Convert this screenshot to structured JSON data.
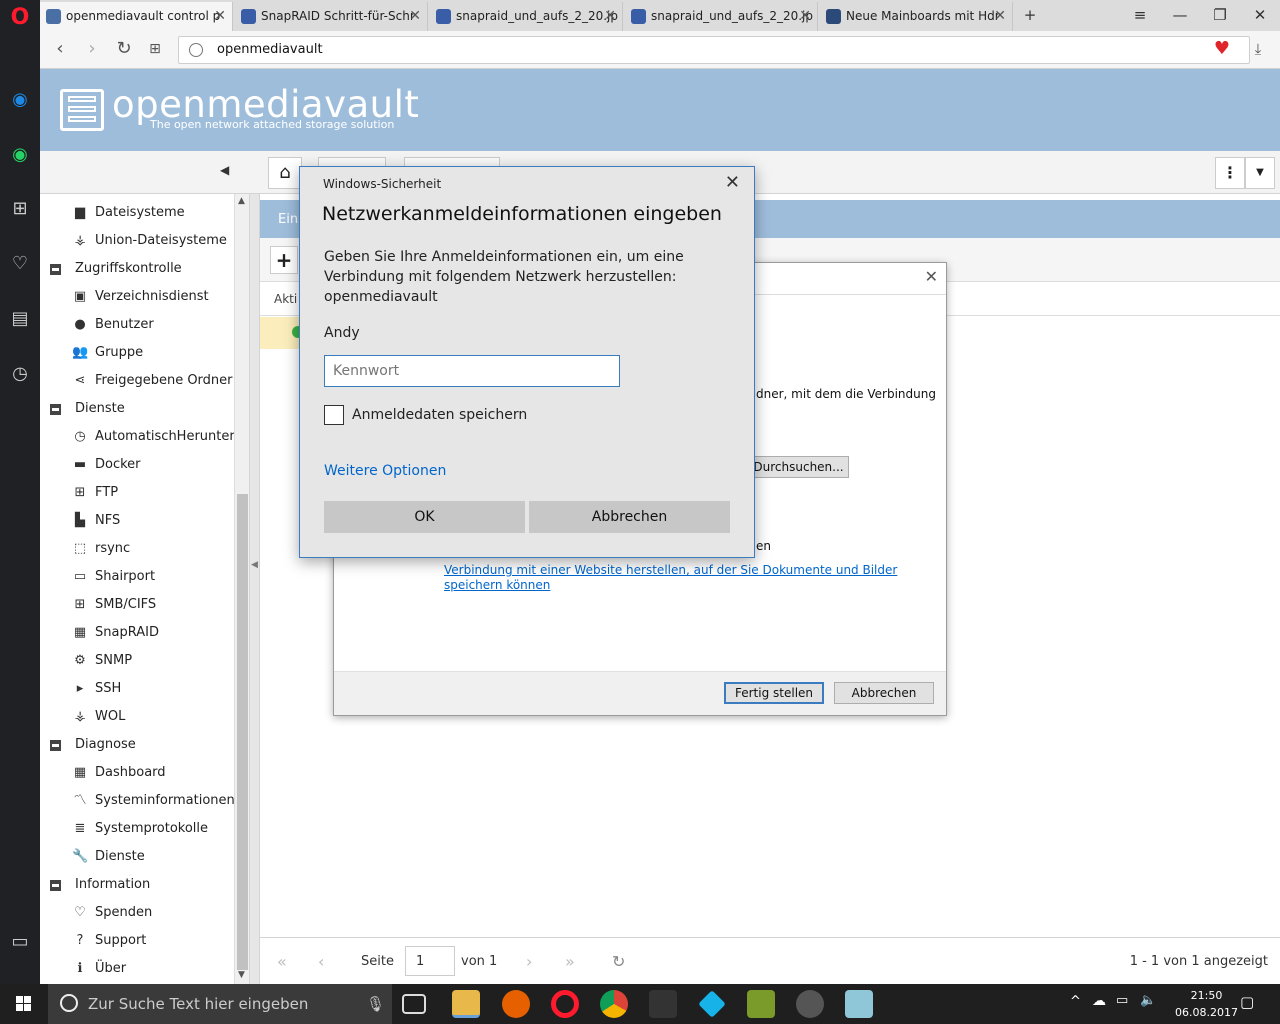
{
  "browser": {
    "tabs": [
      {
        "label": "openmediavault control p",
        "color": "#4a6fa5",
        "active": true
      },
      {
        "label": "SnapRAID Schritt-für-Schr",
        "color": "#3a5da8"
      },
      {
        "label": "snapraid_und_aufs_2_20.jp",
        "color": "#3a5da8"
      },
      {
        "label": "snapraid_und_aufs_2_20.jp",
        "color": "#3a5da8"
      },
      {
        "label": "Neue Mainboards mit Hdr",
        "color": "#2b4a7a"
      }
    ],
    "url": "openmediavault"
  },
  "omv": {
    "logo_title": "openmediavault",
    "logo_subtitle": "The open network attached storage solution",
    "panel_title": "Eins",
    "grid_header": "Akti"
  },
  "nav": {
    "items": [
      {
        "label": "Dateisysteme",
        "icon": "folder-icon",
        "glyph": "▆",
        "group": false
      },
      {
        "label": "Union-Dateisysteme",
        "icon": "hierarchy-icon",
        "glyph": "⚶",
        "group": false
      },
      {
        "label": "Zugriffskontrolle",
        "icon": "collapse-icon",
        "glyph": "",
        "group": true
      },
      {
        "label": "Verzeichnisdienst",
        "icon": "address-book-icon",
        "glyph": "▣",
        "group": false
      },
      {
        "label": "Benutzer",
        "icon": "user-icon",
        "glyph": "●",
        "group": false
      },
      {
        "label": "Gruppe",
        "icon": "users-icon",
        "glyph": "👥",
        "group": false
      },
      {
        "label": "Freigegebene Ordner",
        "icon": "share-icon",
        "glyph": "⋖",
        "group": false
      },
      {
        "label": "Dienste",
        "icon": "collapse-icon",
        "glyph": "",
        "group": true
      },
      {
        "label": "AutomatischHerunterfa",
        "icon": "power-clock-icon",
        "glyph": "◷",
        "group": false
      },
      {
        "label": "Docker",
        "icon": "docker-icon",
        "glyph": "▬",
        "group": false
      },
      {
        "label": "FTP",
        "icon": "ftp-icon",
        "glyph": "⊞",
        "group": false
      },
      {
        "label": "NFS",
        "icon": "nfs-icon",
        "glyph": "▙",
        "group": false
      },
      {
        "label": "rsync",
        "icon": "rsync-icon",
        "glyph": "⬚",
        "group": false
      },
      {
        "label": "Shairport",
        "icon": "airplay-icon",
        "glyph": "▭",
        "group": false
      },
      {
        "label": "SMB/CIFS",
        "icon": "windows-icon",
        "glyph": "⊞",
        "group": false
      },
      {
        "label": "SnapRAID",
        "icon": "snapraid-icon",
        "glyph": "▦",
        "group": false
      },
      {
        "label": "SNMP",
        "icon": "snmp-icon",
        "glyph": "⚙",
        "group": false
      },
      {
        "label": "SSH",
        "icon": "terminal-icon",
        "glyph": "▸",
        "group": false
      },
      {
        "label": "WOL",
        "icon": "network-icon",
        "glyph": "⚶",
        "group": false
      },
      {
        "label": "Diagnose",
        "icon": "collapse-icon",
        "glyph": "",
        "group": true
      },
      {
        "label": "Dashboard",
        "icon": "dashboard-icon",
        "glyph": "▦",
        "group": false
      },
      {
        "label": "Systeminformationen",
        "icon": "chart-line-icon",
        "glyph": "〽",
        "group": false
      },
      {
        "label": "Systemprotokolle",
        "icon": "log-icon",
        "glyph": "≣",
        "group": false
      },
      {
        "label": "Dienste",
        "icon": "wrench-icon",
        "glyph": "🔧",
        "group": false
      },
      {
        "label": "Information",
        "icon": "collapse-icon",
        "glyph": "",
        "group": true
      },
      {
        "label": "Spenden",
        "icon": "heart-icon",
        "glyph": "♡",
        "group": false
      },
      {
        "label": "Support",
        "icon": "question-icon",
        "glyph": "?",
        "group": false
      },
      {
        "label": "Über",
        "icon": "info-icon",
        "glyph": "ℹ",
        "group": false
      }
    ]
  },
  "pager": {
    "page_label": "Seite",
    "page_value": "1",
    "of_label": "von 1",
    "summary": "1 - 1 von 1 angezeigt"
  },
  "wizard": {
    "text_fragment": "dner, mit dem die Verbindung",
    "browse_label": "Durchsuchen...",
    "fragment2": "en",
    "link_text": "Verbindung mit einer Website herstellen, auf der Sie Dokumente und Bilder speichern können",
    "finish_label": "Fertig stellen",
    "cancel_label": "Abbrechen"
  },
  "security_dialog": {
    "caption": "Windows-Sicherheit",
    "title": "Netzwerkanmeldeinformationen eingeben",
    "message": "Geben Sie Ihre Anmeldeinformationen ein, um eine Verbindung mit folgendem Netzwerk herzustellen: openmediavault",
    "username": "Andy",
    "password_placeholder": "Kennwort",
    "remember_label": "Anmeldedaten speichern",
    "more_options": "Weitere Optionen",
    "ok_label": "OK",
    "cancel_label": "Abbrechen"
  },
  "taskbar": {
    "search_placeholder": "Zur Suche Text hier eingeben",
    "time": "21:50",
    "date": "06.08.2017"
  }
}
